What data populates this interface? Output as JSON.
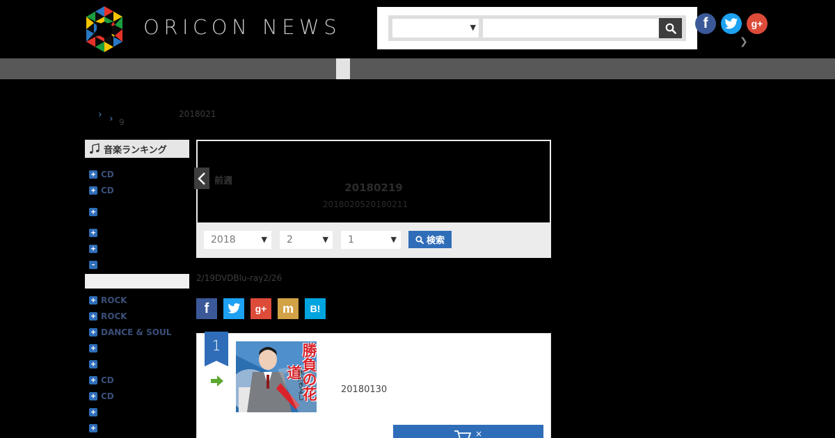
{
  "header": {
    "logo_text": "ORICON NEWS",
    "search": {
      "category_value": "",
      "query_value": "",
      "query_placeholder": ""
    },
    "social": [
      "facebook-icon",
      "twitter-icon",
      "google-plus-icon"
    ],
    "colors": {
      "facebook": "#3b5998",
      "twitter": "#1da1f2",
      "google_plus": "#dd4b39",
      "accent": "#2f6db8"
    }
  },
  "breadcrumb": {
    "sub_label": "9",
    "date_text": "2018021"
  },
  "sidebar": {
    "heading": "音楽ランキング",
    "items": [
      {
        "label": "CD",
        "sign": "+"
      },
      {
        "label": "CD",
        "sign": "+"
      },
      {
        "label": "",
        "sign": "+"
      },
      {
        "label": "",
        "sign": "+"
      },
      {
        "label": "",
        "sign": "+"
      },
      {
        "label": "",
        "sign": "-"
      },
      {
        "label": "ROCK",
        "sign": "+"
      },
      {
        "label": "ROCK",
        "sign": "+"
      },
      {
        "label": "DANCE & SOUL",
        "sign": "+"
      },
      {
        "label": "",
        "sign": "+"
      },
      {
        "label": "",
        "sign": "+"
      },
      {
        "label": "CD",
        "sign": "+"
      },
      {
        "label": "CD",
        "sign": "+"
      },
      {
        "label": "",
        "sign": "+"
      },
      {
        "label": "",
        "sign": "+"
      }
    ]
  },
  "week": {
    "prev_label": "前週",
    "title": "20180219",
    "range": "2018020520180211"
  },
  "filter": {
    "year": "2018",
    "month": "2",
    "week": "1",
    "search_label": "検索"
  },
  "info_text": "2/19DVDBlu-ray2/26",
  "share": {
    "facebook": "f",
    "twitter": "t",
    "google_plus": "g+",
    "mixi": "m",
    "hatena": "B!"
  },
  "ranking": [
    {
      "rank": "1",
      "trend": "same",
      "jacket_title": "勝負の花道",
      "jacket_artist": "氷川きよし",
      "release_date": "20180130",
      "buy_label": "×"
    }
  ]
}
